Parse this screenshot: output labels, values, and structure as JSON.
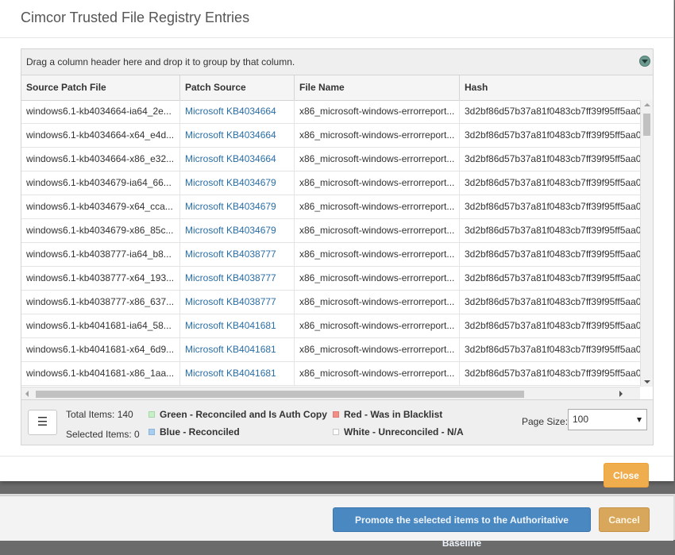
{
  "dialog": {
    "title": "Cimcor Trusted File Registry Entries",
    "close_label": "Close"
  },
  "grid": {
    "group_hint": "Drag a column header here and drop it to group by that column.",
    "columns": [
      "Source Patch File",
      "Patch Source",
      "File Name",
      "Hash"
    ],
    "rows": [
      {
        "source": "windows6.1-kb4034664-ia64_2e...",
        "patch": "Microsoft KB4034664",
        "file": "x86_microsoft-windows-errorreport...",
        "hash": "3d2bf86d57b37a81f0483cb7ff39f95ff5aa0"
      },
      {
        "source": "windows6.1-kb4034664-x64_e4d...",
        "patch": "Microsoft KB4034664",
        "file": "x86_microsoft-windows-errorreport...",
        "hash": "3d2bf86d57b37a81f0483cb7ff39f95ff5aa0"
      },
      {
        "source": "windows6.1-kb4034664-x86_e32...",
        "patch": "Microsoft KB4034664",
        "file": "x86_microsoft-windows-errorreport...",
        "hash": "3d2bf86d57b37a81f0483cb7ff39f95ff5aa0"
      },
      {
        "source": "windows6.1-kb4034679-ia64_66...",
        "patch": "Microsoft KB4034679",
        "file": "x86_microsoft-windows-errorreport...",
        "hash": "3d2bf86d57b37a81f0483cb7ff39f95ff5aa0"
      },
      {
        "source": "windows6.1-kb4034679-x64_cca...",
        "patch": "Microsoft KB4034679",
        "file": "x86_microsoft-windows-errorreport...",
        "hash": "3d2bf86d57b37a81f0483cb7ff39f95ff5aa0"
      },
      {
        "source": "windows6.1-kb4034679-x86_85c...",
        "patch": "Microsoft KB4034679",
        "file": "x86_microsoft-windows-errorreport...",
        "hash": "3d2bf86d57b37a81f0483cb7ff39f95ff5aa0"
      },
      {
        "source": "windows6.1-kb4038777-ia64_b8...",
        "patch": "Microsoft KB4038777",
        "file": "x86_microsoft-windows-errorreport...",
        "hash": "3d2bf86d57b37a81f0483cb7ff39f95ff5aa0"
      },
      {
        "source": "windows6.1-kb4038777-x64_193...",
        "patch": "Microsoft KB4038777",
        "file": "x86_microsoft-windows-errorreport...",
        "hash": "3d2bf86d57b37a81f0483cb7ff39f95ff5aa0"
      },
      {
        "source": "windows6.1-kb4038777-x86_637...",
        "patch": "Microsoft KB4038777",
        "file": "x86_microsoft-windows-errorreport...",
        "hash": "3d2bf86d57b37a81f0483cb7ff39f95ff5aa0"
      },
      {
        "source": "windows6.1-kb4041681-ia64_58...",
        "patch": "Microsoft KB4041681",
        "file": "x86_microsoft-windows-errorreport...",
        "hash": "3d2bf86d57b37a81f0483cb7ff39f95ff5aa0"
      },
      {
        "source": "windows6.1-kb4041681-x64_6d9...",
        "patch": "Microsoft KB4041681",
        "file": "x86_microsoft-windows-errorreport...",
        "hash": "3d2bf86d57b37a81f0483cb7ff39f95ff5aa0"
      },
      {
        "source": "windows6.1-kb4041681-x86_1aa...",
        "patch": "Microsoft KB4041681",
        "file": "x86_microsoft-windows-errorreport...",
        "hash": "3d2bf86d57b37a81f0483cb7ff39f95ff5aa0"
      }
    ]
  },
  "pager": {
    "menu_icon": "hamburger-icon",
    "total_items": "Total Items: 140",
    "selected_items": "Selected Items: 0",
    "legend": {
      "green": "Green - Reconciled and Is Auth Copy",
      "blue": "Blue - Reconciled",
      "red": "Red - Was in Blacklist",
      "white": "White - Unreconciled - N/A"
    },
    "legend_colors": {
      "green": "#c6f0c6",
      "blue": "#a9cdef",
      "red": "#f28e86",
      "white": "#ffffff"
    },
    "page_size_label": "Page Size:",
    "page_size_value": "100"
  },
  "footer": {
    "promote_label": "Promote the selected items to the Authoritative Baseline",
    "cancel_label": "Cancel"
  }
}
